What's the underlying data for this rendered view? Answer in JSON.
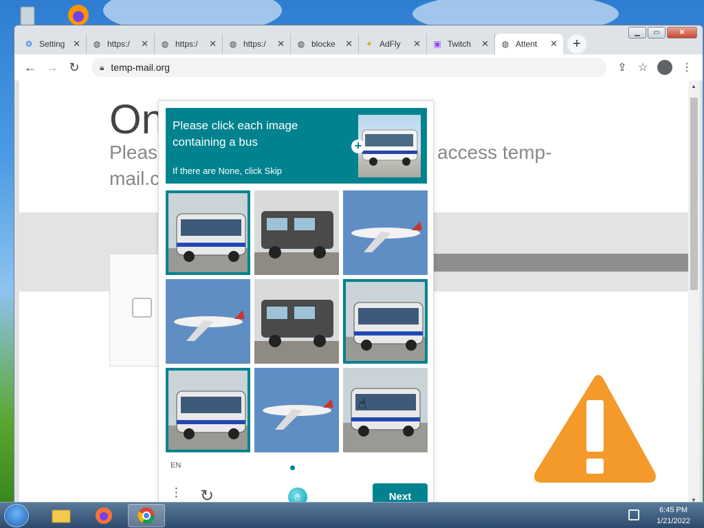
{
  "browser": {
    "tabs": [
      {
        "label": "Setting",
        "icon": "gear-icon",
        "active": false
      },
      {
        "label": "https:/",
        "icon": "globe-icon",
        "active": false
      },
      {
        "label": "https:/",
        "icon": "globe-icon",
        "active": false
      },
      {
        "label": "https:/",
        "icon": "globe-icon",
        "active": false
      },
      {
        "label": "blocke",
        "icon": "globe-icon",
        "active": false
      },
      {
        "label": "AdFly",
        "icon": "adfly-icon",
        "active": false
      },
      {
        "label": "Twitch",
        "icon": "twitch-icon",
        "active": false
      },
      {
        "label": "Attent",
        "icon": "globe-icon",
        "active": true
      }
    ],
    "close_glyph": "✕",
    "new_tab_glyph": "+",
    "url": "temp-mail.org"
  },
  "page": {
    "heading": "On",
    "subtitle_left": "Please",
    "subtitle_right": "access temp-",
    "subtitle_line2": "mail.c"
  },
  "captcha": {
    "prompt_title": "Please click each image containing a bus",
    "prompt_hint": "If there are None, click Skip",
    "language": "EN",
    "next_label": "Next",
    "cells": [
      {
        "subject": "bus",
        "selected": true
      },
      {
        "subject": "train",
        "selected": false
      },
      {
        "subject": "airplane",
        "selected": false
      },
      {
        "subject": "airplane",
        "selected": false
      },
      {
        "subject": "train",
        "selected": false
      },
      {
        "subject": "bus",
        "selected": true
      },
      {
        "subject": "bus",
        "selected": true
      },
      {
        "subject": "airplane",
        "selected": false
      },
      {
        "subject": "bus",
        "selected": false
      }
    ],
    "accent_color": "#00838f"
  },
  "taskbar": {
    "time": "6:45 PM",
    "date": "1/21/2022"
  }
}
